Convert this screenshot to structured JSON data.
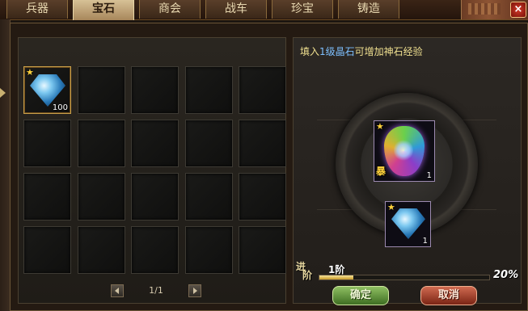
{
  "tabs": [
    {
      "label": "兵器",
      "active": false
    },
    {
      "label": "宝石",
      "active": true
    },
    {
      "label": "商会",
      "active": false
    },
    {
      "label": "战车",
      "active": false
    },
    {
      "label": "珍宝",
      "active": false
    },
    {
      "label": "铸造",
      "active": false
    }
  ],
  "close_label": "×",
  "inventory": {
    "rows": 4,
    "cols": 5,
    "items": [
      {
        "slot": 0,
        "icon": "blue-diamond-gem-icon",
        "star": "★",
        "quantity": "100"
      }
    ]
  },
  "pager": {
    "text": "1/1"
  },
  "hint": {
    "prefix": "填入",
    "highlight": "1级晶石",
    "suffix": "可增加神石经验"
  },
  "main_gem": {
    "icon": "rainbow-divine-stone-icon",
    "star": "★",
    "badge": "暴",
    "quantity": "1"
  },
  "feed_gem": {
    "icon": "blue-diamond-gem-icon",
    "star": "★",
    "quantity": "1"
  },
  "level": {
    "badge_top": "进",
    "badge_bottom": "阶",
    "num": "1阶",
    "progress": 0.2,
    "percent_label": "20%"
  },
  "buttons": {
    "confirm": "确定",
    "cancel": "取消"
  },
  "colors": {
    "hint_text": "#f0e090",
    "highlight": "#7ec0ff",
    "progress_fill": "#e0c050"
  }
}
